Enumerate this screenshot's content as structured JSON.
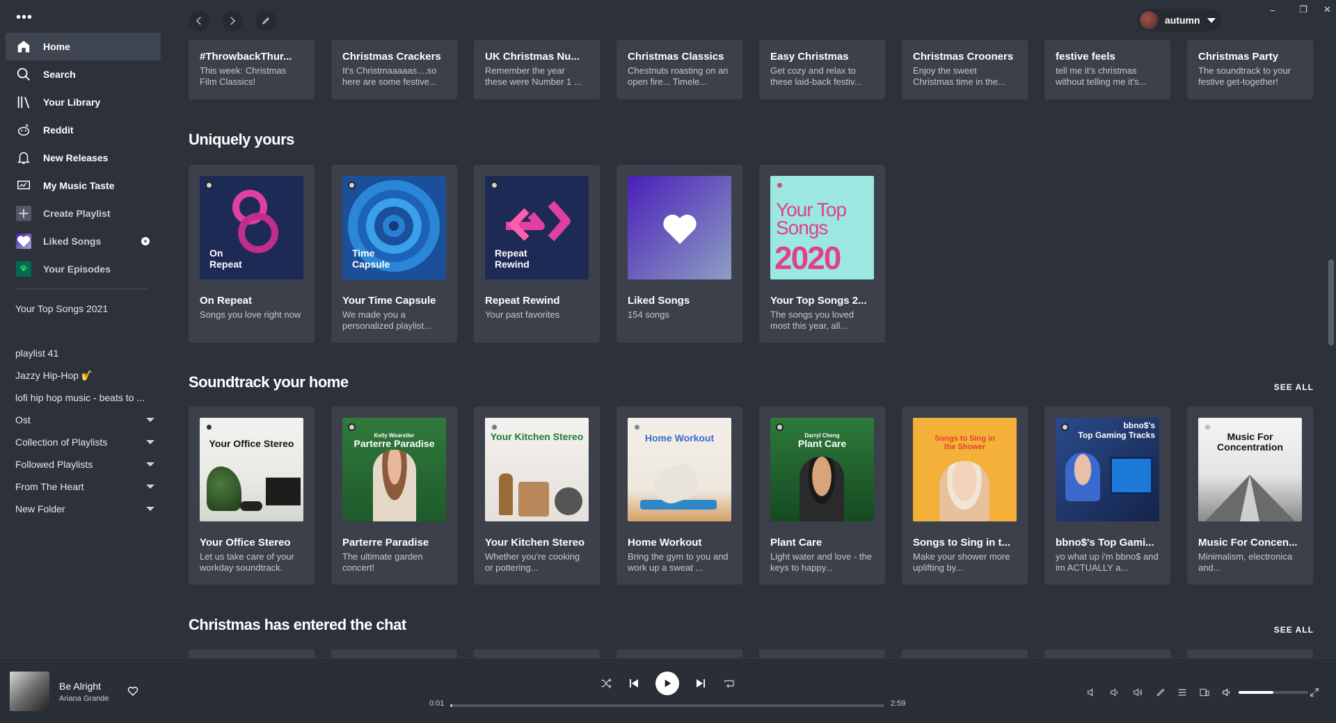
{
  "window": {
    "user_name": "autumn",
    "minimize": "–",
    "restore": "❐",
    "close": "✕"
  },
  "sidebar": {
    "menu_dots": "•••",
    "nav": [
      {
        "label": "Home",
        "icon": "home-icon"
      },
      {
        "label": "Search",
        "icon": "search-icon"
      },
      {
        "label": "Your Library",
        "icon": "library-icon"
      },
      {
        "label": "Reddit",
        "icon": "reddit-icon"
      },
      {
        "label": "New Releases",
        "icon": "bell-icon"
      },
      {
        "label": "My Music Taste",
        "icon": "music-taste-icon"
      },
      {
        "label": "Create Playlist",
        "icon": "plus-icon"
      },
      {
        "label": "Liked Songs",
        "icon": "liked-songs-icon"
      },
      {
        "label": "Your Episodes",
        "icon": "episodes-icon"
      }
    ],
    "playlists_top": "Your Top Songs 2021",
    "playlists": [
      {
        "label": "playlist 41",
        "folder": false
      },
      {
        "label": "Jazzy Hip-Hop 🎷",
        "folder": false
      },
      {
        "label": "lofi hip hop music - beats to ...",
        "folder": false
      },
      {
        "label": "Ost",
        "folder": true
      },
      {
        "label": "Collection of Playlists",
        "folder": true
      },
      {
        "label": "Followed Playlists",
        "folder": true
      },
      {
        "label": "From The Heart",
        "folder": true
      },
      {
        "label": "New Folder",
        "folder": true
      }
    ]
  },
  "top_row": [
    {
      "title": "#ThrowbackThur...",
      "desc": "This week: Christmas Film Classics!"
    },
    {
      "title": "Christmas Crackers",
      "desc": "It's Christmaaaaas....so here are some festive..."
    },
    {
      "title": "UK Christmas Nu...",
      "desc": "Remember the year these were Number 1 ..."
    },
    {
      "title": "Christmas Classics",
      "desc": "Chestnuts roasting on an open fire... Timele..."
    },
    {
      "title": "Easy Christmas",
      "desc": "Get cozy and relax to these laid-back festiv..."
    },
    {
      "title": "Christmas Crooners",
      "desc": "Enjoy the sweet Christmas time in the..."
    },
    {
      "title": "festive feels",
      "desc": "tell me it's christmas without telling me it's..."
    },
    {
      "title": "Christmas Party",
      "desc": "The soundtrack to your festive get-together!"
    }
  ],
  "uniquely_yours": {
    "heading": "Uniquely yours",
    "cards": [
      {
        "title": "On Repeat",
        "desc": "Songs you love right now",
        "art_label_1": "On",
        "art_label_2": "Repeat"
      },
      {
        "title": "Your Time Capsule",
        "desc": "We made you a personalized playlist...",
        "art_label_1": "Time",
        "art_label_2": "Capsule"
      },
      {
        "title": "Repeat Rewind",
        "desc": "Your past favorites",
        "art_label_1": "Repeat",
        "art_label_2": "Rewind"
      },
      {
        "title": "Liked Songs",
        "desc": "154 songs"
      },
      {
        "title": "Your Top Songs 2...",
        "desc": "The songs you loved most this year, all...",
        "art_line_1": "Your Top",
        "art_line_2": "Songs",
        "art_line_3": "2020"
      }
    ]
  },
  "soundtrack_home": {
    "heading": "Soundtrack your home",
    "see_all": "SEE ALL",
    "cards": [
      {
        "title": "Your Office Stereo",
        "desc": "Let us take care of your workday soundtrack.",
        "art_text": "Your Office Stereo"
      },
      {
        "title": "Parterre Paradise",
        "desc": "The ultimate garden concert!",
        "art_small": "Kelly Wearstler",
        "art_text": "Parterre Paradise"
      },
      {
        "title": "Your Kitchen Stereo",
        "desc": "Whether you're cooking or pottering...",
        "art_text": "Your Kitchen Stereo"
      },
      {
        "title": "Home Workout",
        "desc": "Bring the gym to you and work up a sweat ...",
        "art_text": "Home Workout"
      },
      {
        "title": "Plant Care",
        "desc": "Light water and love - the keys to happy...",
        "art_small": "Darryl Cheng",
        "art_text": "Plant Care"
      },
      {
        "title": "Songs to Sing in t...",
        "desc": "Make your shower more uplifting by...",
        "art_text": "Songs to Sing in the Shower"
      },
      {
        "title": "bbno$'s Top Gami...",
        "desc": "yo what up i'm bbno$ and im ACTUALLY a...",
        "art_small": "bbno$'s",
        "art_text": "Top Gaming Tracks"
      },
      {
        "title": "Music For Concen...",
        "desc": "Minimalism, electronica and...",
        "art_text": "Music For Concentration"
      }
    ]
  },
  "christmas_chat": {
    "heading": "Christmas has entered the chat",
    "see_all": "SEE ALL"
  },
  "player": {
    "track_title": "Be Alright",
    "track_artist": "Ariana Grande",
    "time_elapsed": "0:01",
    "time_total": "2:59",
    "progress": 0.005,
    "volume": 0.5
  }
}
